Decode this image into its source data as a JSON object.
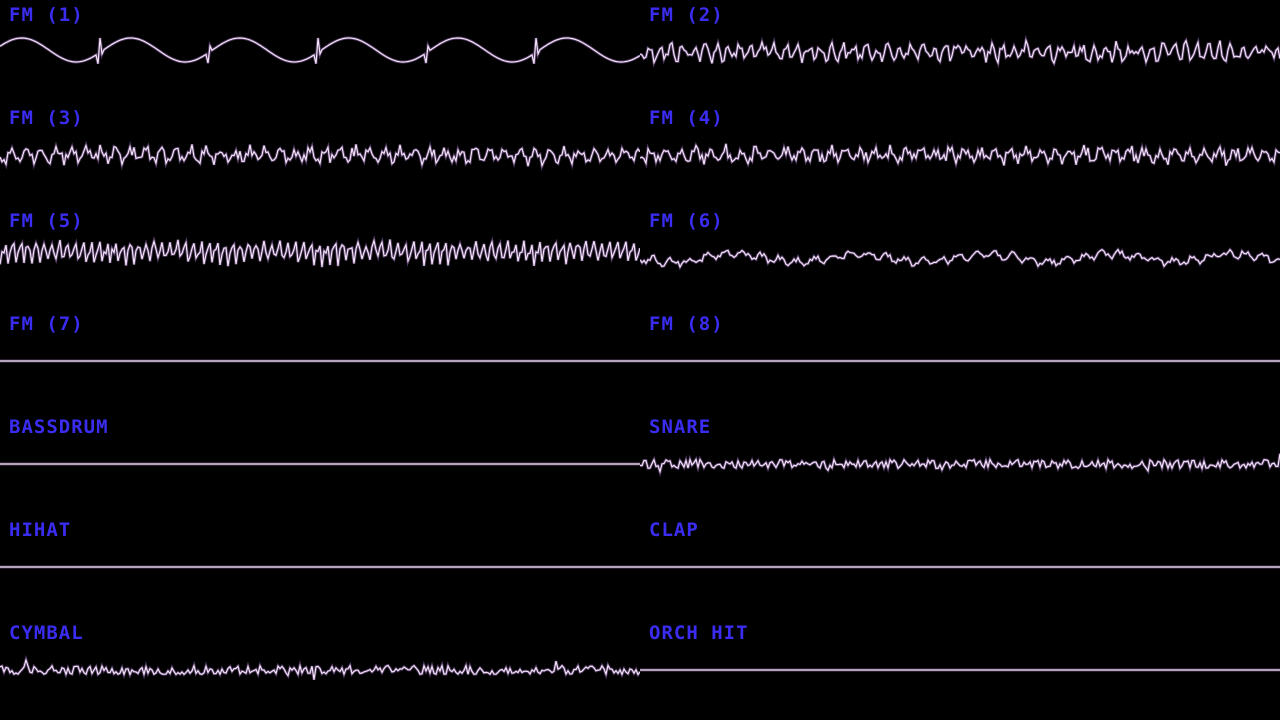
{
  "colors": {
    "background": "#000000",
    "label": "#3a2cf0",
    "trace": "#f2e4f4",
    "trace_glow": "#b07ad8"
  },
  "channels": [
    {
      "label": "FM (1)",
      "waveform": "sawtooth-sine"
    },
    {
      "label": "FM (2)",
      "waveform": "dense-jagged"
    },
    {
      "label": "FM (3)",
      "waveform": "jagged"
    },
    {
      "label": "FM (4)",
      "waveform": "jagged"
    },
    {
      "label": "FM (5)",
      "waveform": "dense-spikes"
    },
    {
      "label": "FM (6)",
      "waveform": "wobbly"
    },
    {
      "label": "FM (7)",
      "waveform": "flat"
    },
    {
      "label": "FM (8)",
      "waveform": "flat"
    },
    {
      "label": "BASSDRUM",
      "waveform": "flat"
    },
    {
      "label": "SNARE",
      "waveform": "noise"
    },
    {
      "label": "HIHAT",
      "waveform": "flat"
    },
    {
      "label": "CLAP",
      "waveform": "flat"
    },
    {
      "label": "CYMBAL",
      "waveform": "noise"
    },
    {
      "label": "ORCH HIT",
      "waveform": "flat"
    }
  ]
}
